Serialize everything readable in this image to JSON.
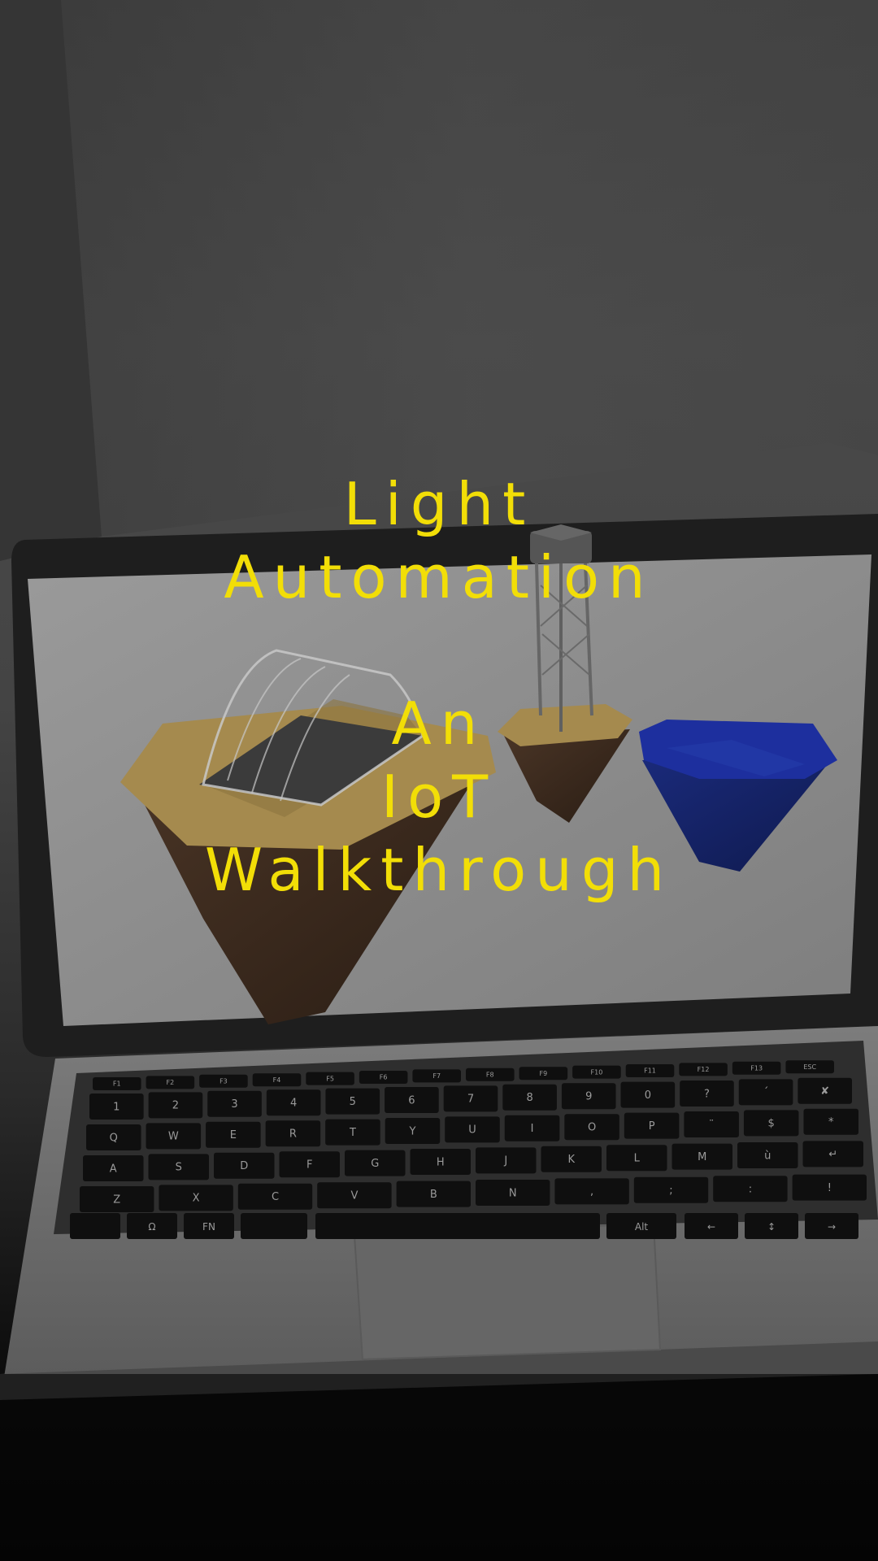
{
  "overlay": {
    "title_lines": [
      "Light",
      "Automation"
    ],
    "subtitle_lines": [
      "An",
      "IoT",
      "Walkthrough"
    ],
    "text_color": "#f2de07"
  },
  "scene": {
    "icons": [
      "laptop-icon",
      "floating-island-greenhouse-icon",
      "floating-island-water-tower-icon",
      "floating-island-water-icon"
    ],
    "colors": {
      "background": "#444444",
      "laptop_body": "#7a7a7a",
      "screen": "#8d8d8d",
      "soil": "#a58a4e",
      "rock": "#3a2a1e",
      "water": "#1d2f9e"
    },
    "keyboard": {
      "fn_row": [
        "F1",
        "F2",
        "F3",
        "F4",
        "F5",
        "F6",
        "F7",
        "F8",
        "F9",
        "F10",
        "F11",
        "F12",
        "F13",
        "ESC"
      ],
      "row_1": [
        "1",
        "2",
        "3",
        "4",
        "5",
        "6",
        "7",
        "8",
        "9",
        "0",
        "?",
        "´",
        "✘"
      ],
      "row_2": [
        "Q",
        "W",
        "E",
        "R",
        "T",
        "Y",
        "U",
        "I",
        "O",
        "P",
        "¨",
        "$",
        "*"
      ],
      "row_3": [
        "A",
        "S",
        "D",
        "F",
        "G",
        "H",
        "J",
        "K",
        "L",
        "M",
        "ù",
        "↵"
      ],
      "row_4": [
        "Z",
        "X",
        "C",
        "V",
        "B",
        "N",
        ",",
        ";",
        ":",
        "!"
      ],
      "row_5_left": [
        "Ω",
        "FN"
      ],
      "row_5_right": [
        "Alt",
        "←",
        "↕",
        "→"
      ]
    }
  }
}
